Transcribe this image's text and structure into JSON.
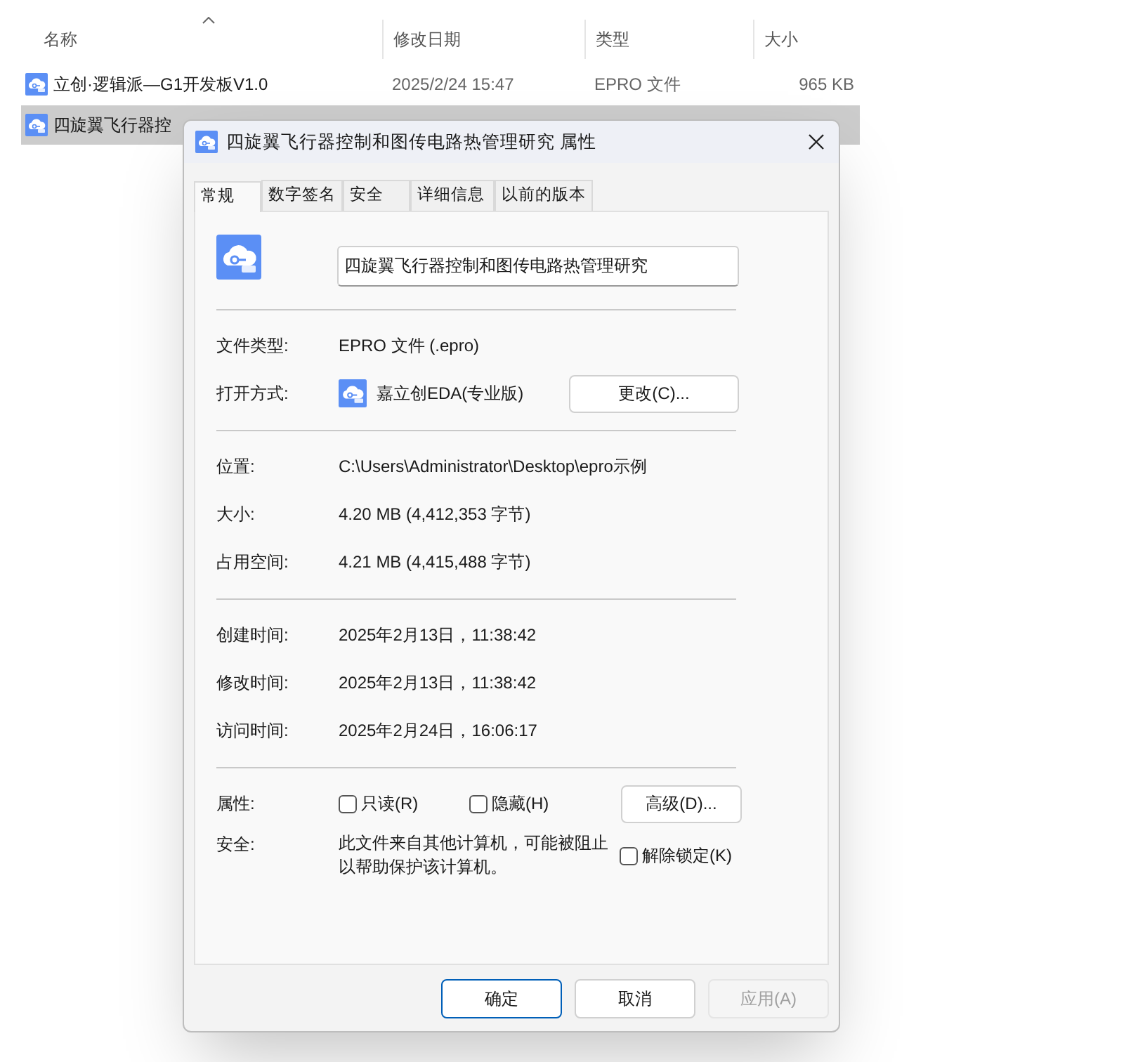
{
  "explorer": {
    "columns": [
      "名称",
      "修改日期",
      "类型",
      "大小"
    ],
    "files": [
      {
        "name": "立创·逻辑派—G1开发板V1.0",
        "date": "2025/2/24 15:47",
        "type": "EPRO 文件",
        "size": "965 KB",
        "selected": false
      },
      {
        "name": "四旋翼飞行器控",
        "selected": true
      }
    ]
  },
  "dialog": {
    "title": "四旋翼飞行器控制和图传电路热管理研究 属性",
    "tabs": [
      {
        "label": "常规",
        "selected": true
      },
      {
        "label": "数字签名",
        "selected": false
      },
      {
        "label": "安全",
        "selected": false
      },
      {
        "label": "详细信息",
        "selected": false
      },
      {
        "label": "以前的版本",
        "selected": false
      }
    ],
    "file_name": "四旋翼飞行器控制和图传电路热管理研究",
    "sections": [
      [
        {
          "kind": "text",
          "label": "文件类型:",
          "value": "EPRO 文件 (.epro)"
        },
        {
          "kind": "app",
          "label": "打开方式:",
          "value": "嘉立创EDA(专业版)",
          "button": "更改(C)..."
        }
      ],
      [
        {
          "kind": "text",
          "label": "位置:",
          "value": "C:\\Users\\Administrator\\Desktop\\epro示例"
        },
        {
          "kind": "text",
          "label": "大小:",
          "value": "4.20 MB (4,412,353 字节)"
        },
        {
          "kind": "text",
          "label": "占用空间:",
          "value": "4.21 MB (4,415,488 字节)"
        }
      ],
      [
        {
          "kind": "text",
          "label": "创建时间:",
          "value": "2025年2月13日，11:38:42"
        },
        {
          "kind": "text",
          "label": "修改时间:",
          "value": "2025年2月13日，11:38:42"
        },
        {
          "kind": "text",
          "label": "访问时间:",
          "value": "2025年2月24日，16:06:17"
        }
      ],
      [
        {
          "kind": "checks",
          "label": "属性:",
          "checks": [
            {
              "label": "只读(R)",
              "checked": false
            },
            {
              "label": "隐藏(H)",
              "checked": false
            }
          ],
          "button": "高级(D)..."
        },
        {
          "kind": "security",
          "label": "安全:",
          "value": "此文件来自其他计算机，可能被阻止以帮助保护该计算机。",
          "check": {
            "label": "解除锁定(K)",
            "checked": false
          }
        }
      ]
    ],
    "buttons": [
      {
        "label": "确定",
        "default": true,
        "disabled": false
      },
      {
        "label": "取消",
        "default": false,
        "disabled": false
      },
      {
        "label": "应用(A)",
        "default": false,
        "disabled": true
      }
    ]
  }
}
